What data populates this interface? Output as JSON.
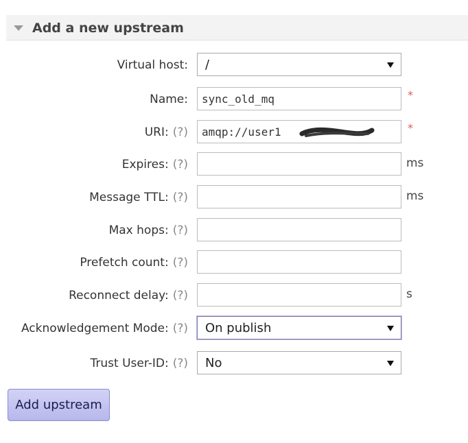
{
  "header": {
    "title": "Add a new upstream"
  },
  "help_marker": "(?)",
  "required_marker": "*",
  "form": {
    "virtual_host": {
      "label": "Virtual host:",
      "value": "/"
    },
    "name": {
      "label": "Name:",
      "value": "sync_old_mq"
    },
    "uri": {
      "label": "URI:",
      "value": "amqp://user1"
    },
    "expires": {
      "label": "Expires:",
      "value": "",
      "unit": "ms"
    },
    "message_ttl": {
      "label": "Message TTL:",
      "value": "",
      "unit": "ms"
    },
    "max_hops": {
      "label": "Max hops:",
      "value": ""
    },
    "prefetch_count": {
      "label": "Prefetch count:",
      "value": ""
    },
    "reconnect_delay": {
      "label": "Reconnect delay:",
      "value": "",
      "unit": "s"
    },
    "ack_mode": {
      "label": "Acknowledgement Mode:",
      "value": "On publish"
    },
    "trust_user_id": {
      "label": "Trust User-ID:",
      "value": "No"
    }
  },
  "submit": {
    "label": "Add upstream"
  },
  "colors": {
    "header_bg": "#f3f3f3",
    "required": "#e05a5a",
    "button_bg": "#c4c4f1"
  }
}
